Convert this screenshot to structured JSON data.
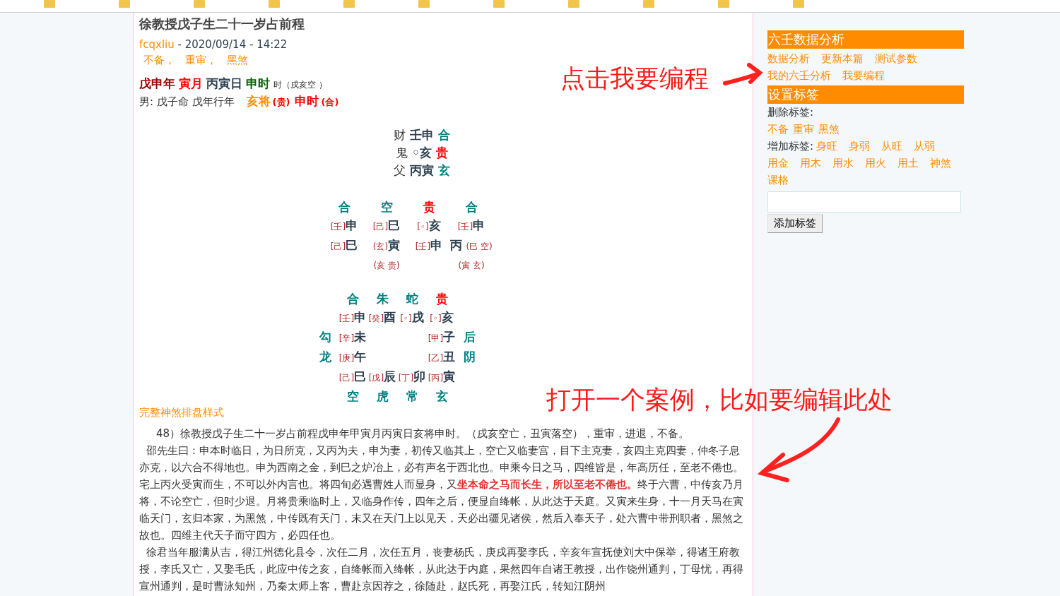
{
  "post": {
    "title": "徐教授戊子生二十一岁占前程",
    "author": "fcqxliu",
    "date": " - 2020/09/14 - 14:22",
    "tags": [
      "不备，",
      "重审，",
      "黑煞"
    ],
    "pillars": [
      {
        "text": "戊申年",
        "kind": "year"
      },
      {
        "text": "寅月",
        "kind": "month"
      },
      {
        "text": "丙寅日",
        "kind": "day"
      },
      {
        "text": "申时",
        "kind": "hour"
      },
      {
        "text": "时（戌亥空 ）",
        "kind": "note"
      }
    ],
    "person": "男: 戊子命  戊年行年",
    "general": [
      {
        "text": "亥将",
        "kind": "orange"
      },
      {
        "text": "(贵)",
        "kind": "small"
      },
      {
        "text": "申时",
        "kind": "red"
      },
      {
        "text": "(合)",
        "kind": "small"
      }
    ],
    "transmissions": [
      {
        "relation": "财",
        "branch": "壬申",
        "god": "合",
        "color": "#008080"
      },
      {
        "relation": "鬼",
        "branch": "◦亥",
        "god": "贵",
        "color": "#ff0000"
      },
      {
        "relation": "父",
        "branch": "丙寅",
        "god": "玄",
        "color": "#008080"
      }
    ],
    "lessons": [
      {
        "god": "合",
        "color": "#008080",
        "top_stem": "[壬]",
        "top": "申",
        "bottom_prefix": "[己]",
        "bottom": "巳"
      },
      {
        "god": "空",
        "color": "#008080",
        "top_stem": "[己]",
        "top": "巳",
        "bottom_prefix": "(玄)",
        "bottom": "寅",
        "note": "(亥 贵)"
      },
      {
        "god": "贵",
        "color": "#ff0000",
        "top_stem": "[◦]",
        "top": "亥",
        "bottom_prefix": "[壬]",
        "bottom": "申"
      },
      {
        "god": "合",
        "color": "#008080",
        "top_stem": "[壬]",
        "top": "申",
        "bottom": "丙",
        "bottom_suffix": "(巳 空)",
        "note": "(寅 玄)"
      }
    ],
    "plate": {
      "top": [
        {
          "stem": "[壬]",
          "branch": "申",
          "god": "合",
          "color": "#008080"
        },
        {
          "stem": "[癸]",
          "branch": "酉",
          "god": "朱",
          "color": "#008080"
        },
        {
          "stem": "[◦]",
          "branch": "戌",
          "god": "蛇",
          "color": "#008080"
        },
        {
          "stem": "[◦]",
          "branch": "亥",
          "god": "贵",
          "color": "#ff0000"
        }
      ],
      "left": [
        {
          "stem": "[辛]",
          "branch": "未",
          "god": "勾",
          "color": "#008080"
        },
        {
          "stem": "[庚]",
          "branch": "午",
          "god": "龙",
          "color": "#008080"
        }
      ],
      "right": [
        {
          "stem": "[甲]",
          "branch": "子",
          "god": "后",
          "color": "#008080"
        },
        {
          "stem": "[乙]",
          "branch": "丑",
          "god": "阴",
          "color": "#008080"
        }
      ],
      "bottom": [
        {
          "stem": "[己]",
          "branch": "巳",
          "god": "空",
          "color": "#008080"
        },
        {
          "stem": "[戊]",
          "branch": "辰",
          "god": "虎",
          "color": "#008080"
        },
        {
          "stem": "[丁]",
          "branch": "卯",
          "god": "常",
          "color": "#008080"
        },
        {
          "stem": "[丙]",
          "branch": "寅",
          "god": "玄",
          "color": "#008080"
        }
      ]
    },
    "full_link": "完整神煞排盘样式",
    "paragraphs": [
      "48）徐教授戊子生二十一岁占前程戊申年甲寅月丙寅日亥将申时。（戌亥空亡，丑寅落空），重审，进退，不备。",
      "邵先生曰：申本时临日，为日所克，又丙为夫，申为妻，初传又临其上，空亡又临妻宫，目下主克妻，亥四主克四妻，仲冬子息亦克，以六合不得地也。申为西南之金，到巳之炉冶上，必有声名于西北也。申乘今日之马，四维皆是，年高历任，至老不倦也。宅上丙火受寅而生，不可以外内言也。将四旬必遇曹姓人而显身，又**坐本命之马而长生，所以至老不倦也。**终于六曹，中传亥乃月将，不论空亡，但时少退。月将贵乘临时上，又临身作传，四年之后，便显自绛帐，从此达于天庭。又寅来生身，十一月天马在寅临天门，玄归本家，为黑煞，中传既有天门，末又在天门上以见天，天必出疆见诸侯，然后入奉天子，处六曹中带刑职者，黑煞之故也。四维主代天子而守四方，必四任也。",
      "徐君当年服满从吉，得江州德化县令，次任二月，次任五月，丧妻杨氏，庚戌再娶李氏，辛亥年宣抚使刘大中保举，得诸王府教授，李氏又亡，又娶毛氏，此应中传之亥，自绛帐而入绛帐，从此达于内庭，果然四年自诸王教授，出作饶州通判，丁母忧，再得宣州通判，是时曹泳知州，乃秦太师上客，曹赴京因荐之，徐随赴，赵氏死，再娶江氏，转知江阴州"
    ]
  },
  "sidebar": {
    "analysis_title": "六壬数据分析",
    "analysis_links": [
      "数据分析",
      "更新本篇",
      "测试参数",
      "我的六壬分析",
      "我要编程"
    ],
    "tags_title": "设置标签",
    "delete_label": "删除标签:",
    "delete_tags": [
      "不备",
      "重审",
      "黑煞"
    ],
    "add_label": "增加标签:",
    "add_tags": [
      "身旺",
      "身弱",
      "从旺",
      "从弱",
      "用金",
      "用木",
      "用水",
      "用火",
      "用土",
      "神煞",
      "课格"
    ],
    "add_button": "添加标签"
  },
  "annotations": [
    {
      "text": "点击我要编程",
      "kind": "right"
    },
    {
      "text": "打开一个案例，比如要编辑此处",
      "kind": "down"
    }
  ]
}
